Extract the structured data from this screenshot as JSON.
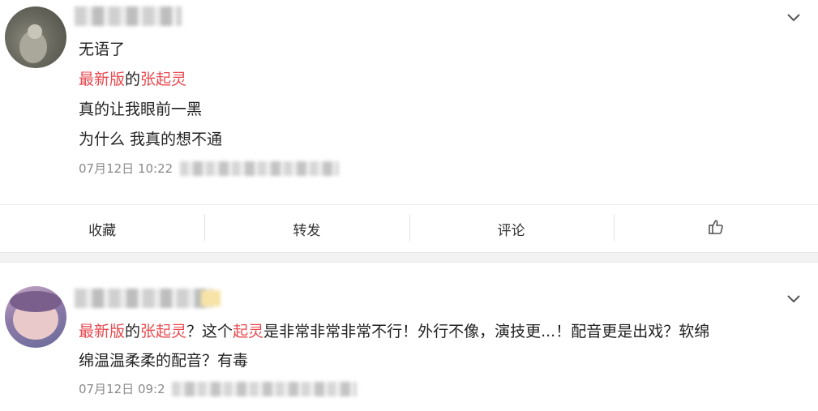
{
  "post1": {
    "avatar_alt": "user avatar",
    "lines": [
      "无语了",
      "真的让我眼前一黑",
      "为什么 我真的想不通"
    ],
    "line2": {
      "red1": "最新版",
      "plain": "的",
      "red2": "张起灵"
    },
    "meta": "07月12日 10:22"
  },
  "actions": {
    "collect": "收藏",
    "repost": "转发",
    "comment": "评论",
    "like_icon": "thumbs-up-icon"
  },
  "post2": {
    "avatar_alt": "user avatar",
    "line1": {
      "red1": "最新版",
      "p1": "的",
      "red2": "张起灵",
      "p2": "？这个",
      "red3": "起灵",
      "p3": "是非常非常非常不行！外行不像，演技更...！配音更是出戏？软绵"
    },
    "line2": "绵温温柔柔的配音？有毒",
    "meta": "07月12日 09:2"
  },
  "colors": {
    "accent_red": "#e8494f",
    "meta_gray": "#8a8a8a",
    "divider": "#ebebeb"
  }
}
